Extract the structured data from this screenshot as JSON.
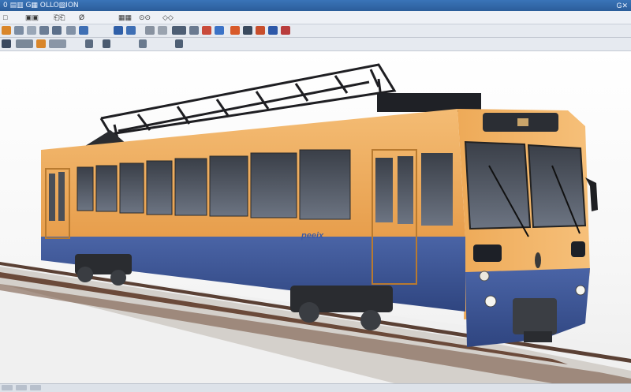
{
  "app": {
    "title": "0 ▤▥ G▦ OLLO▧ION",
    "window_controls": "G✕"
  },
  "menu": {
    "items": [
      "□",
      "▣▣",
      "⎗⎗",
      "Ø",
      "▦▦",
      "⊙⊙",
      "◇◇"
    ]
  },
  "toolbar": {
    "row1": [
      "#d9862a",
      "#7c8da3",
      "#9aa7b7",
      "#6b7d95",
      "#5b6f8a",
      "#8191a6",
      "#3f6fb4",
      "#2f5fa8",
      "#8892a0",
      "#9aa3af",
      "#4d5e74",
      "#6a7a90",
      "#c94b3b",
      "#3b72c6",
      "#d85a2a",
      "#3a4a5e",
      "#c84e2c",
      "#2d58a8",
      "#b93d3d"
    ],
    "row2": [
      "#3b4a60",
      "#7a8898",
      "#d9862a",
      "#8a96a6",
      "#5b6b80",
      "#4a5a70",
      "#6a7a8e",
      "#4f6075"
    ]
  },
  "scene": {
    "subject": "tram-3d-model",
    "body_color": "#f0b063",
    "skirt_color": "#3f5796",
    "logo_text": "рееіх"
  },
  "statusbar": {
    "segments": [
      "",
      "",
      ""
    ]
  }
}
